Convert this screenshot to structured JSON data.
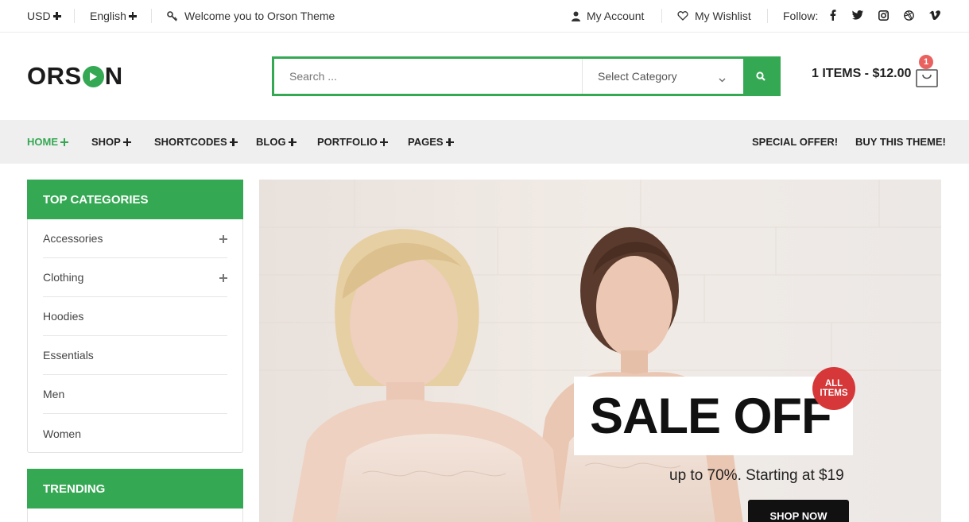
{
  "topbar": {
    "currency": "USD",
    "language": "English",
    "welcome": "Welcome you to Orson Theme",
    "my_account": "My Account",
    "my_wishlist": "My Wishlist",
    "follow_label": "Follow:",
    "social_icons": [
      "facebook-icon",
      "twitter-icon",
      "instagram-icon",
      "dribbble-icon",
      "vimeo-icon"
    ]
  },
  "header": {
    "logo_left": "ORS",
    "logo_right": "N",
    "search_placeholder": "Search ...",
    "category_select": "Select Category",
    "cart_summary": "1 ITEMS - $12.00",
    "cart_count": "1"
  },
  "nav": {
    "items": [
      {
        "label": "HOME",
        "active": true
      },
      {
        "label": "SHOP"
      },
      {
        "label": "SHORTCODES"
      },
      {
        "label": "BLOG"
      },
      {
        "label": "PORTFOLIO"
      },
      {
        "label": "PAGES"
      }
    ],
    "special_offer": "SPECIAL OFFER!",
    "buy_theme": "BUY THIS THEME!"
  },
  "sidebar": {
    "top_categories_title": "TOP CATEGORIES",
    "categories": [
      {
        "label": "Accessories",
        "expandable": true
      },
      {
        "label": "Clothing",
        "expandable": true
      },
      {
        "label": "Hoodies"
      },
      {
        "label": "Essentials"
      },
      {
        "label": "Men"
      },
      {
        "label": "Women"
      }
    ],
    "trending_title": "TRENDING"
  },
  "banner": {
    "headline": "SALE OFF",
    "badge_line1": "ALL",
    "badge_line2": "ITEMS",
    "subtext": "up to 70%. Starting at $19",
    "button": "SHOP NOW"
  },
  "colors": {
    "accent": "#35a853",
    "nav_bg": "#efefef",
    "badge_red": "#d63738",
    "cart_badge": "#e9625f"
  }
}
